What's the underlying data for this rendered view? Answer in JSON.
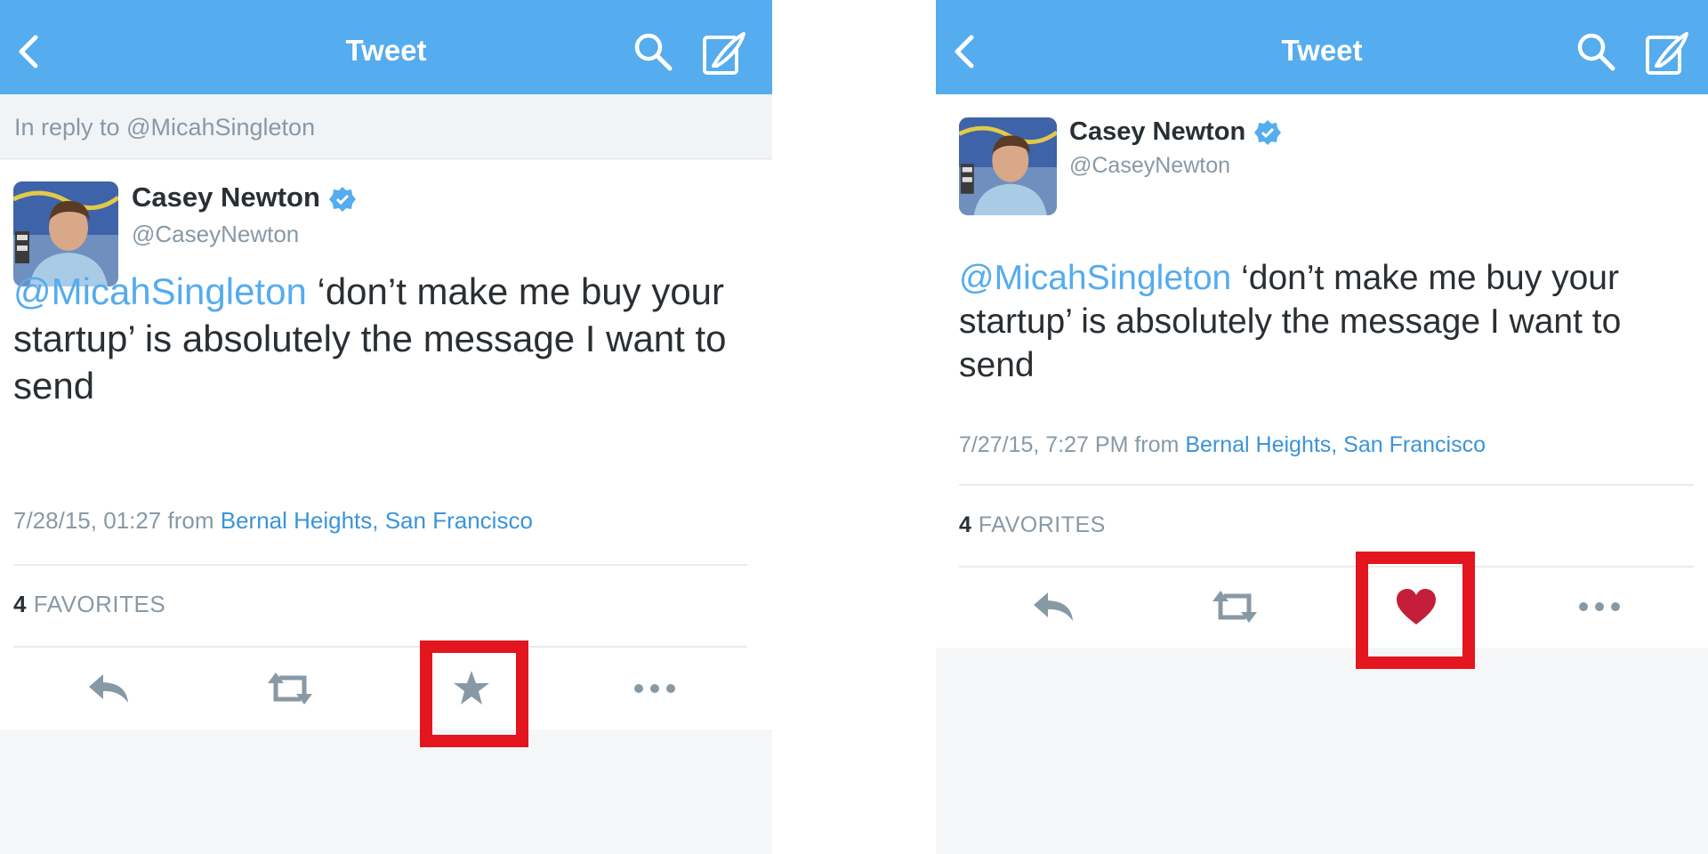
{
  "left": {
    "nav": {
      "title": "Tweet"
    },
    "reply_to": "In reply to @MicahSingleton",
    "tweet": {
      "author_name": "Casey Newton",
      "author_handle": "@CaseyNewton",
      "mention": "@MicahSingleton",
      "text": " ‘don’t make me buy your startup’ is absolutely the message I want to send",
      "date": "7/28/15, 01:27",
      "from": "from",
      "location": "Bernal Heights, San Francisco",
      "favorites_count": "4",
      "favorites_label": "FAVORITES"
    },
    "actions": [
      "reply-icon",
      "retweet-icon",
      "star-icon",
      "more-icon"
    ],
    "highlighted_action": "star-icon"
  },
  "right": {
    "nav": {
      "title": "Tweet"
    },
    "tweet": {
      "author_name": "Casey Newton",
      "author_handle": "@CaseyNewton",
      "mention": "@MicahSingleton",
      "text": " ‘don’t make me buy your startup’ is absolutely the message I want to send",
      "date": "7/27/15, 7:27 PM",
      "from": "from",
      "location": "Bernal Heights, San Francisco",
      "favorites_count": "4",
      "favorites_label": "FAVORITES"
    },
    "actions": [
      "reply-icon",
      "retweet-icon",
      "heart-icon",
      "more-icon"
    ],
    "highlighted_action": "heart-icon"
  },
  "colors": {
    "brand": "#55acee",
    "link": "#3b94d9",
    "highlight": "#e3161f",
    "heart": "#c41e3a",
    "icon_gray": "#8899a6"
  }
}
